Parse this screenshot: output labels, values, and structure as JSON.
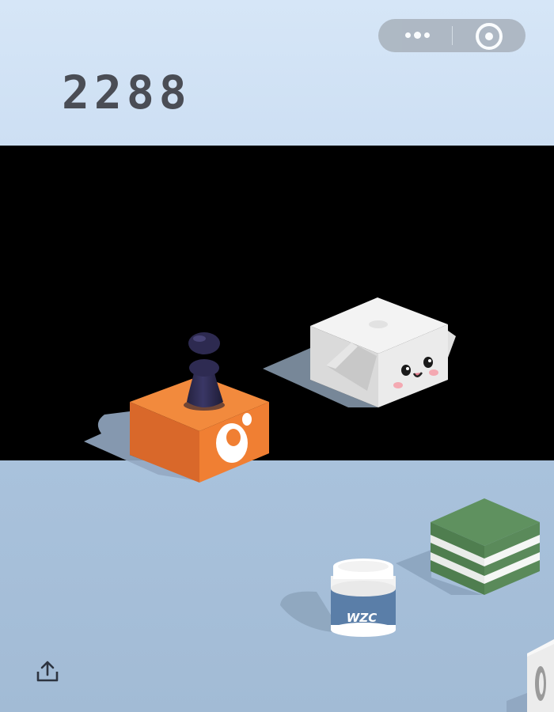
{
  "score": "2288",
  "capsule": {
    "more_icon": "more-dots-icon",
    "close_icon": "target-close-icon"
  },
  "share": {
    "icon": "share-upload-icon"
  },
  "bottle": {
    "label": "WZC"
  },
  "colors": {
    "sky_top": "#d3e4f6",
    "floor": "#a7bfd9",
    "orange_box": "#f1843a",
    "piece": "#2f2c4f",
    "green_box": "#5a8a5a"
  }
}
